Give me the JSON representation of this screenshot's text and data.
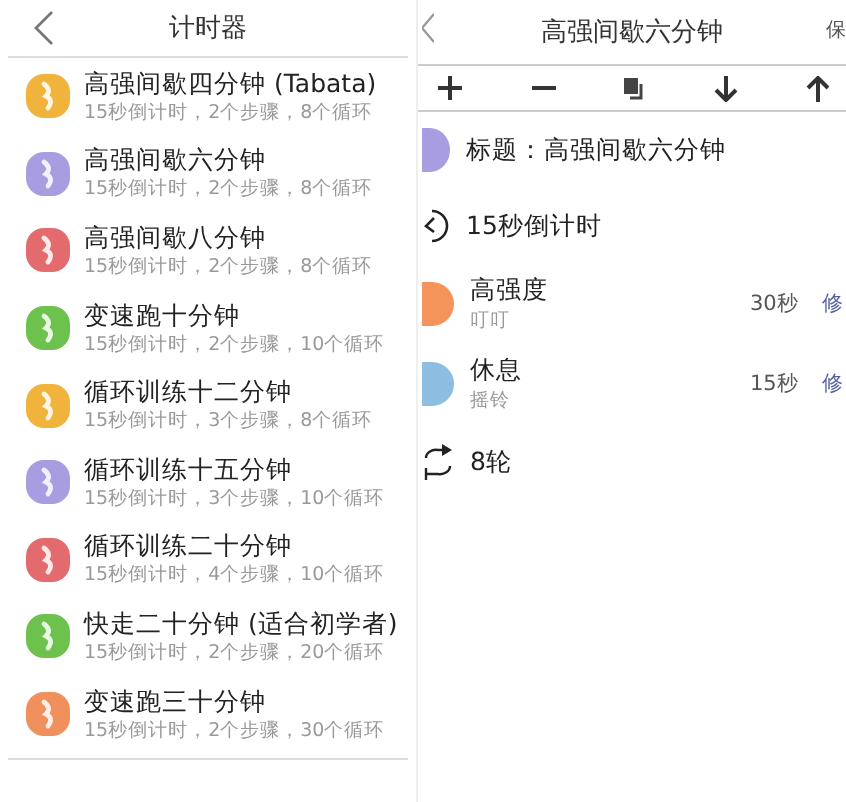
{
  "timer_list": {
    "title": "计时器",
    "items": [
      {
        "name": "高强间歇四分钟 (Tabata)",
        "detail": "15秒倒计时，2个步骤，8个循环",
        "color": "#f0b33c"
      },
      {
        "name": "高强间歇六分钟",
        "detail": "15秒倒计时，2个步骤，8个循环",
        "color": "#a99de2"
      },
      {
        "name": "高强间歇八分钟",
        "detail": "15秒倒计时，2个步骤，8个循环",
        "color": "#e36b6e"
      },
      {
        "name": "变速跑十分钟",
        "detail": "15秒倒计时，2个步骤，10个循环",
        "color": "#6cc24c"
      },
      {
        "name": "循环训练十二分钟",
        "detail": "15秒倒计时，3个步骤，8个循环",
        "color": "#f0b33c"
      },
      {
        "name": "循环训练十五分钟",
        "detail": "15秒倒计时，3个步骤，10个循环",
        "color": "#a99de2"
      },
      {
        "name": "循环训练二十分钟",
        "detail": "15秒倒计时，4个步骤，10个循环",
        "color": "#e36b6e"
      },
      {
        "name": "快走二十分钟 (适合初学者)",
        "detail": "15秒倒计时，2个步骤，20个循环",
        "color": "#6cc24c"
      },
      {
        "name": "变速跑三十分钟",
        "detail": "15秒倒计时，2个步骤，30个循环",
        "color": "#f0905c"
      }
    ]
  },
  "timer_editor": {
    "title": "高强间歇六分钟",
    "save": "保",
    "heading": "标题：高强间歇六分钟",
    "countdown": "15秒倒计时",
    "steps": [
      {
        "name": "高强度",
        "sound": "叮叮",
        "duration": "30秒",
        "edit": "修",
        "color": "#f4935a"
      },
      {
        "name": "休息",
        "sound": "摇铃",
        "duration": "15秒",
        "edit": "修",
        "color": "#8dbde0"
      }
    ],
    "rounds": "8轮"
  }
}
